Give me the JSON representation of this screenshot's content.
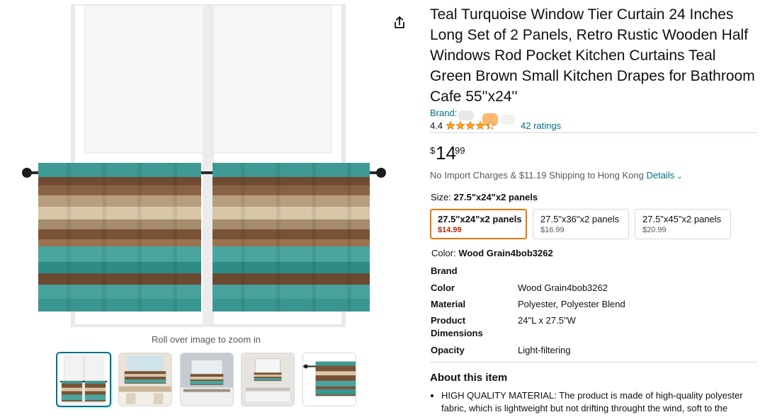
{
  "gallery": {
    "zoom_hint": "Roll over image to zoom in",
    "share_icon": "share-icon",
    "thumbnails": [
      {
        "name": "thumb-1",
        "selected": true
      },
      {
        "name": "thumb-2",
        "selected": false
      },
      {
        "name": "thumb-3",
        "selected": false
      },
      {
        "name": "thumb-4",
        "selected": false
      },
      {
        "name": "thumb-5",
        "selected": false
      }
    ]
  },
  "product": {
    "title": "Teal Turquoise Window Tier Curtain 24 Inches Long Set of 2 Panels, Retro Rustic Wooden Half Windows Rod Pocket Kitchen Curtains Teal Green Brown Small Kitchen Drapes for Bathroom Cafe 55''x24''",
    "brand_label": "Brand:",
    "rating_value": "4.4",
    "rating_stars": 4.4,
    "ratings_count": "42 ratings",
    "price_symbol": "$",
    "price_whole": "14",
    "price_fraction": "99",
    "shipping_text": "No Import Charges & $11.19 Shipping to Hong Kong",
    "details_link": "Details",
    "size_label": "Size:",
    "size_selected": "27.5\"x24\"x2 panels",
    "size_options": [
      {
        "name": "27.5\"x24\"x2 panels",
        "price": "$14.99",
        "selected": true
      },
      {
        "name": "27.5\"x36\"x2 panels",
        "price": "$16.99",
        "selected": false
      },
      {
        "name": "27.5\"x45\"x2 panels",
        "price": "$20.99",
        "selected": false
      }
    ],
    "color_label": "Color:",
    "color_selected": "Wood Grain4bob3262",
    "specs": [
      {
        "key": "Brand",
        "value": ""
      },
      {
        "key": "Color",
        "value": "Wood Grain4bob3262"
      },
      {
        "key": "Material",
        "value": "Polyester, Polyester Blend"
      },
      {
        "key": "Product Dimensions",
        "value": "24\"L x 27.5\"W"
      },
      {
        "key": "Opacity",
        "value": "Light-filtering"
      }
    ],
    "about_title": "About this item",
    "about_items": [
      "HIGH QUALITY MATERIAL: The product is made of high-quality polyester fabric, which is lightweight but not drifting throught the wind, soft to the"
    ]
  },
  "colors": {
    "link": "#007185",
    "price_red": "#b12704",
    "selected_orange": "#e77600",
    "star": "#ffa41c",
    "teal": "#3f9a95",
    "wood_brown": "#7a5236"
  }
}
